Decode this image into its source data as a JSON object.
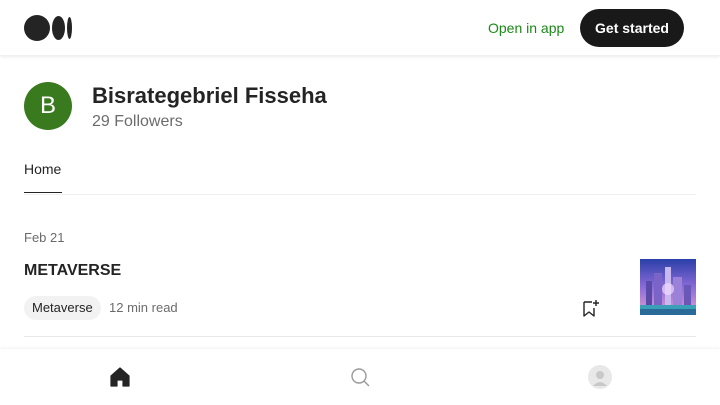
{
  "header": {
    "logo_icon": "medium-logo-icon",
    "open_in_app": "Open in app",
    "get_started": "Get started",
    "accent_color": "#1a8917"
  },
  "profile": {
    "avatar_initial": "B",
    "avatar_color": "#3a7a1f",
    "name": "Bisrategebriel Fisseha",
    "followers": "29 Followers"
  },
  "tabs": [
    {
      "label": "Home",
      "active": true
    }
  ],
  "posts": [
    {
      "date": "Feb 21",
      "title": "METAVERSE",
      "tag": "Metaverse",
      "read_time": "12 min read",
      "bookmark_icon": "bookmark-add-icon",
      "thumbnail": "metaverse-city-thumbnail"
    }
  ],
  "bottom_nav": [
    {
      "icon": "home-icon",
      "active": true
    },
    {
      "icon": "search-icon",
      "active": false
    },
    {
      "icon": "profile-icon",
      "active": false
    }
  ]
}
